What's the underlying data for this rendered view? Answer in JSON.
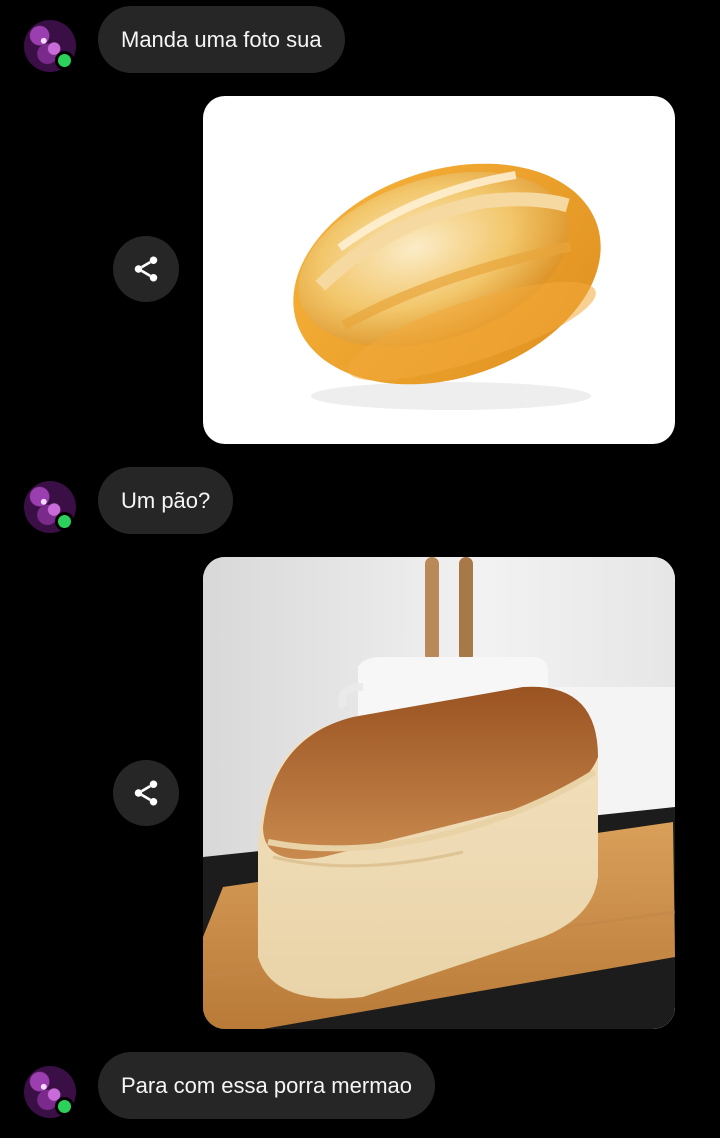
{
  "messages": [
    {
      "type": "text",
      "sender": "other",
      "text": "Manda uma foto sua"
    },
    {
      "type": "image",
      "sender": "me",
      "image": "french-roll-bread-photo",
      "action_icon": "share-icon"
    },
    {
      "type": "text",
      "sender": "other",
      "text": "Um pão?"
    },
    {
      "type": "image",
      "sender": "me",
      "image": "loaf-bread-on-board-photo",
      "action_icon": "share-icon"
    },
    {
      "type": "text",
      "sender": "other",
      "text": "Para com essa porra mermao"
    }
  ],
  "colors": {
    "background": "#000000",
    "bubble": "#262626",
    "bubble_text": "#f5f5f5",
    "online_indicator": "#2bd15a"
  }
}
